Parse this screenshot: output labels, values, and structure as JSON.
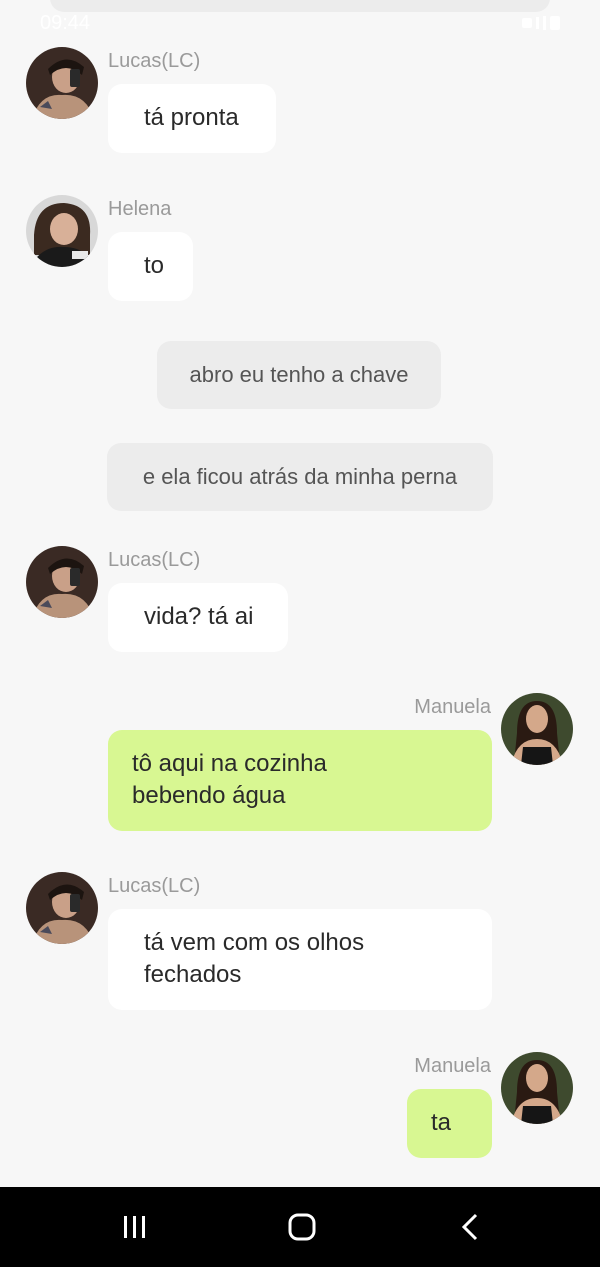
{
  "status_bar": {
    "time": "09:44"
  },
  "messages": [
    {
      "type": "incoming",
      "sender": "Lucas(LC)",
      "avatar": "lucas",
      "text": "tá pronta"
    },
    {
      "type": "incoming",
      "sender": "Helena",
      "avatar": "helena",
      "text": "to"
    },
    {
      "type": "system",
      "text": "abro eu tenho a chave"
    },
    {
      "type": "system",
      "text": "e ela ficou atrás da minha perna"
    },
    {
      "type": "incoming",
      "sender": "Lucas(LC)",
      "avatar": "lucas",
      "text": "vida? tá ai"
    },
    {
      "type": "outgoing",
      "sender": "Manuela",
      "avatar": "manuela",
      "text_lines": [
        "tô aqui na cozinha",
        "bebendo água"
      ]
    },
    {
      "type": "incoming",
      "sender": "Lucas(LC)",
      "avatar": "lucas",
      "text_lines": [
        "tá vem com os olhos",
        "fechados"
      ]
    },
    {
      "type": "outgoing",
      "sender": "Manuela",
      "avatar": "manuela",
      "text": "ta"
    }
  ],
  "nav_bar": {
    "buttons": [
      "recent-apps",
      "home",
      "back"
    ]
  },
  "colors": {
    "background": "#f7f7f7",
    "incoming_bubble": "#ffffff",
    "outgoing_bubble": "#d8f792",
    "system_bubble": "#ececec",
    "nav_bar": "#000000"
  }
}
